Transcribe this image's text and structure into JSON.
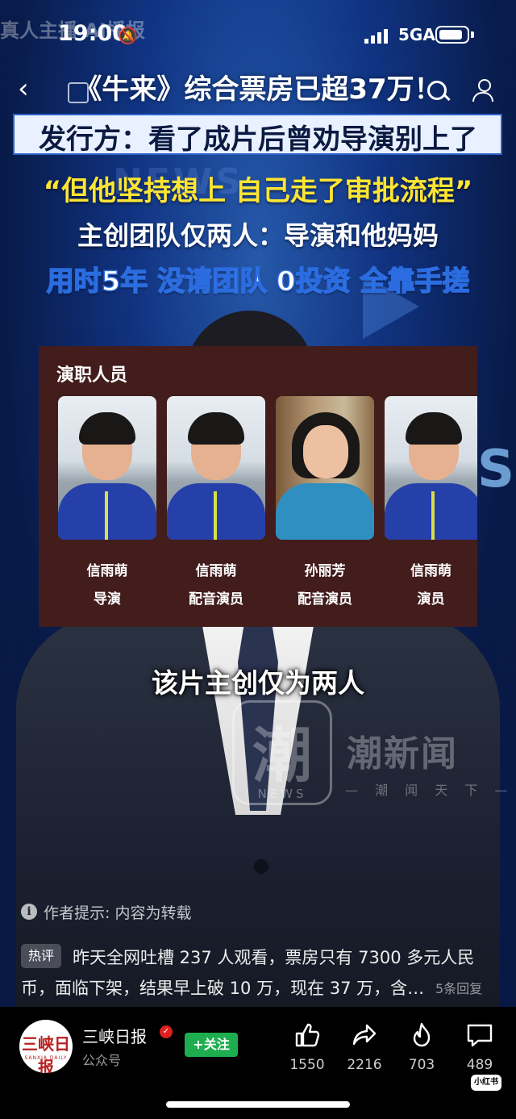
{
  "status_bar": {
    "time": "19:00",
    "overlay_text": "真人主播 AI播报",
    "network": "5GA"
  },
  "headline": {
    "line1": "《牛来》综合票房已超37万！",
    "line2": "发行方：看了成片后曾劝导演别上了",
    "line3": "“但他坚持想上 自己走了审批流程”",
    "line4": "主创团队仅两人：导演和他妈妈",
    "line5": "用时5年 没请团队 0投资 全靠手搓"
  },
  "background": {
    "news_text": "NEWS",
    "side_letter": "S"
  },
  "cast_panel": {
    "title": "演职人员",
    "members": [
      {
        "name": "信雨萌",
        "role": "导演"
      },
      {
        "name": "信雨萌",
        "role": "配音演员"
      },
      {
        "name": "孙丽芳",
        "role": "配音演员"
      },
      {
        "name": "信雨萌",
        "role": "演员"
      }
    ]
  },
  "subtitle": "该片主创仅为两人",
  "watermark": {
    "logo_char": "潮",
    "logo_sub": "NEWS",
    "name": "潮新闻",
    "slogan": "— 潮 闻 天 下 —"
  },
  "notice": {
    "icon": "i",
    "text": "作者提示: 内容为转载"
  },
  "hot_comment": {
    "badge": "热评",
    "line1": "昨天全网吐槽 237 人观看，票房只有 7300 多元人民",
    "line2": "币，面临下架，结果早上破 10 万，现在 37 万，含…",
    "reply_count": "5条回复"
  },
  "bottom_bar": {
    "publisher_logo_text": "三峡日报",
    "publisher_logo_sub": "SANXIA DAILY",
    "publisher_name": "三峡日报",
    "publisher_type": "公众号",
    "follow_label": "+关注",
    "actions": [
      {
        "icon": "thumbs-up-icon",
        "count": "1550"
      },
      {
        "icon": "share-arrow-icon",
        "count": "2216"
      },
      {
        "icon": "flame-icon",
        "count": "703"
      },
      {
        "icon": "comment-bubble-icon",
        "count": "489"
      }
    ],
    "app_badge": "小红书"
  },
  "colors": {
    "cast_panel_bg": "#431c1c",
    "headline_yellow": "#ffe533",
    "follow_green": "#1fae4f"
  }
}
